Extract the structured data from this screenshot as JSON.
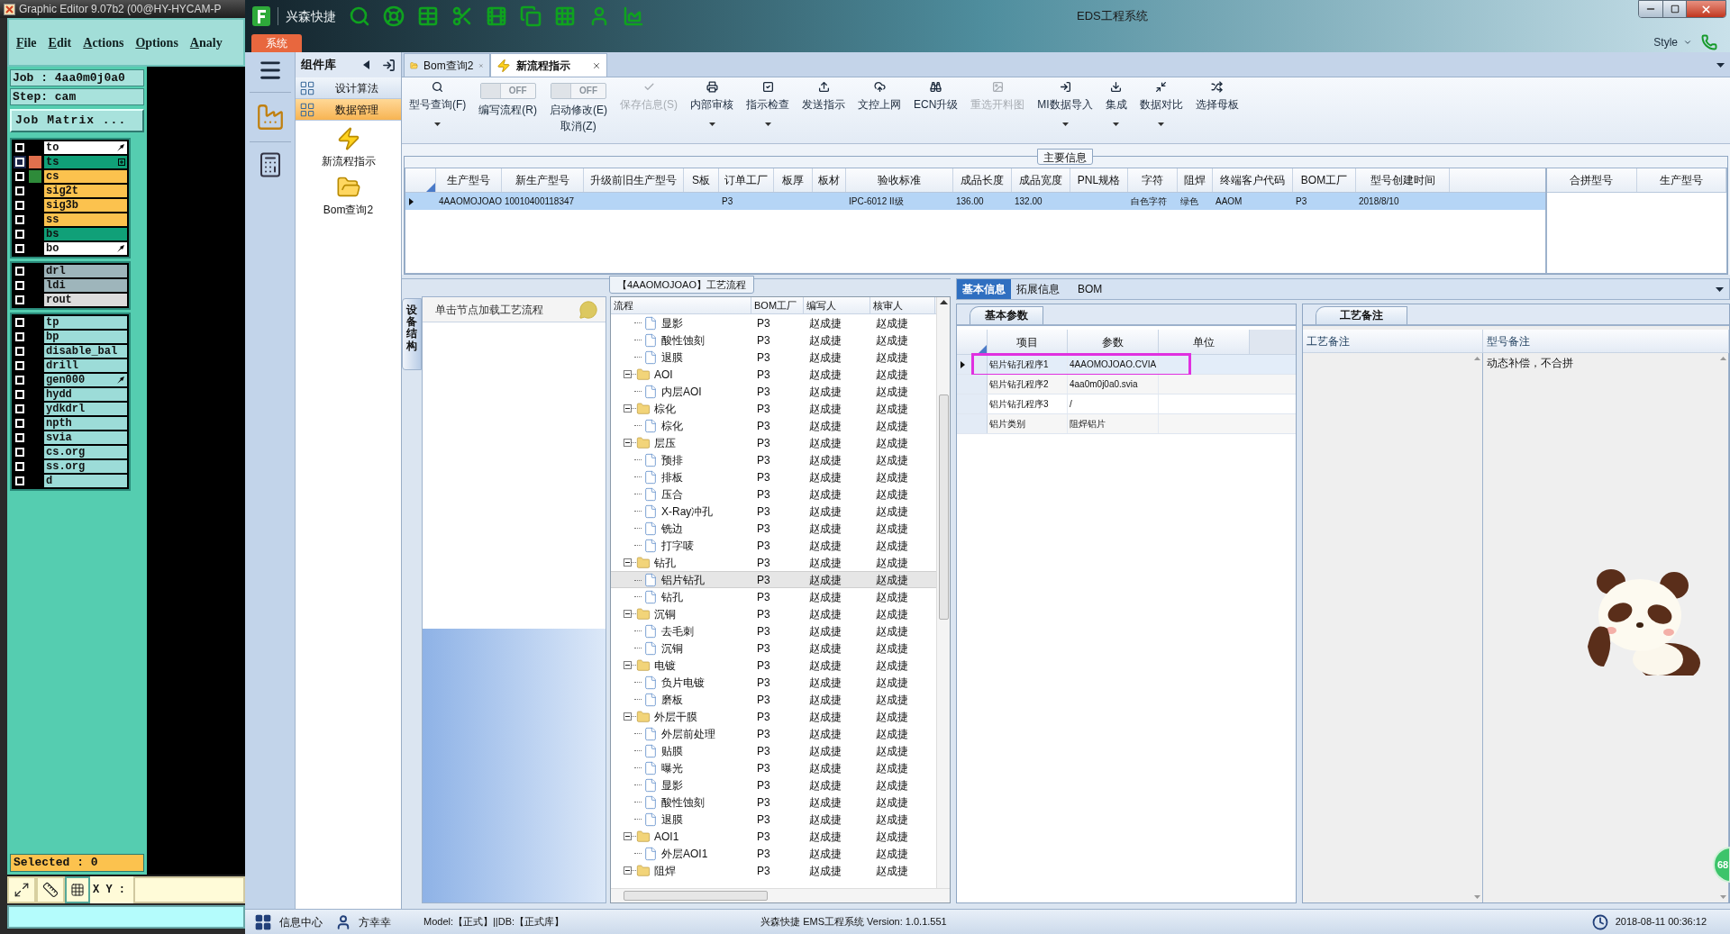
{
  "editor": {
    "title": "Graphic Editor 9.07b2 (00@HY-HYCAM-P",
    "menu": [
      "File",
      "Edit",
      "Actions",
      "Options",
      "Analy"
    ],
    "job": "Job : 4aa0m0j0a0",
    "step": "Step: cam",
    "matrix_button": "Job Matrix ...",
    "layer_groups": [
      {
        "layers": [
          {
            "name": "to",
            "color": "#ffffff",
            "selected": false,
            "marker": {
              "kind": "arrow"
            }
          },
          {
            "name": "ts",
            "color": "#10a078",
            "chip": {
              "color": "#e0704e"
            },
            "selected": true,
            "marker": {
              "kind": "plus"
            }
          },
          {
            "name": "cs",
            "color": "#fcc24e",
            "chip": {
              "color": "#2e8b3a"
            },
            "selected": false
          },
          {
            "name": "sig2t",
            "color": "#fcc24e",
            "selected": false
          },
          {
            "name": "sig3b",
            "color": "#fcc24e",
            "selected": false
          },
          {
            "name": "ss",
            "color": "#fcc24e",
            "selected": false
          },
          {
            "name": "bs",
            "color": "#10a078",
            "selected": false
          },
          {
            "name": "bo",
            "color": "#ffffff",
            "selected": false,
            "marker": {
              "kind": "arrow"
            }
          }
        ]
      },
      {
        "layers": [
          {
            "name": "drl",
            "color": "#9eb5bb",
            "selected": false
          },
          {
            "name": "ldi",
            "color": "#9eb5bb",
            "selected": false
          },
          {
            "name": "rout",
            "color": "#dcdcdc",
            "selected": false
          }
        ]
      },
      {
        "layers": [
          {
            "name": "tp",
            "color": "#9cdcd8",
            "selected": false
          },
          {
            "name": "bp",
            "color": "#9cdcd8",
            "selected": false
          },
          {
            "name": "disable_bal",
            "color": "#9cdcd8",
            "selected": false
          },
          {
            "name": "drill",
            "color": "#9cdcd8",
            "selected": false
          },
          {
            "name": "gen000",
            "color": "#9cdcd8",
            "selected": false,
            "marker": {
              "kind": "arrow"
            }
          },
          {
            "name": "hydd",
            "color": "#9cdcd8",
            "selected": false
          },
          {
            "name": "ydkdrl",
            "color": "#9cdcd8",
            "selected": false
          },
          {
            "name": "npth",
            "color": "#9cdcd8",
            "selected": false
          },
          {
            "name": "svia",
            "color": "#9cdcd8",
            "selected": false
          },
          {
            "name": "cs.org",
            "color": "#9cdcd8",
            "selected": false
          },
          {
            "name": "ss.org",
            "color": "#9cdcd8",
            "selected": false
          },
          {
            "name": "d",
            "color": "#9cdcd8",
            "selected": false
          }
        ]
      }
    ],
    "selected_count": "Selected : 0",
    "xy_label": "X Y :"
  },
  "app": {
    "quick_title": "兴森快捷",
    "title": "EDS工程系统",
    "system_tab": "系统",
    "style": "Style",
    "side": {
      "header": "组件库",
      "sections": [
        {
          "label": "设计算法",
          "selected": false
        },
        {
          "label": "数据管理",
          "selected": true
        }
      ],
      "shortcuts": [
        {
          "label": "新流程指示",
          "kind": "bolt"
        },
        {
          "label": "Bom查询2",
          "kind": "folder"
        }
      ]
    },
    "tabs": [
      {
        "label": "Bom查询2",
        "kind": "folder",
        "selected": false
      },
      {
        "label": "新流程指示",
        "kind": "bolt",
        "selected": true
      }
    ],
    "toolbar": [
      {
        "kind": "button",
        "label": "型号查询(F)",
        "disabled": false,
        "dropdown": true
      },
      {
        "kind": "toggle",
        "label": "编写流程(R)",
        "switch_text": "OFF",
        "on": false
      },
      {
        "kind": "toggle",
        "label": "启动修改(E)",
        "label2": "取消(Z)",
        "switch_text": "OFF",
        "on": false
      },
      {
        "kind": "button",
        "label": "保存信息(S)",
        "disabled": true,
        "dropdown": false
      },
      {
        "kind": "button",
        "label": "内部审核",
        "disabled": false,
        "dropdown": true
      },
      {
        "kind": "button",
        "label": "指示检查",
        "disabled": false,
        "dropdown": true
      },
      {
        "kind": "button",
        "label": "发送指示",
        "disabled": false,
        "dropdown": false
      },
      {
        "kind": "button",
        "label": "文控上网",
        "disabled": false,
        "dropdown": false
      },
      {
        "kind": "button",
        "label": "ECN升级",
        "disabled": false,
        "dropdown": false
      },
      {
        "kind": "button",
        "label": "重选开料图",
        "disabled": true,
        "dropdown": false
      },
      {
        "kind": "button",
        "label": "MI数据导入",
        "disabled": false,
        "dropdown": true
      },
      {
        "kind": "button",
        "label": "集成",
        "disabled": false,
        "dropdown": true
      },
      {
        "kind": "button",
        "label": "数据对比",
        "disabled": false,
        "dropdown": true
      },
      {
        "kind": "button",
        "label": "选择母板",
        "disabled": false,
        "dropdown": false
      }
    ],
    "main_info": {
      "title": "主要信息",
      "columns": [
        "生产型号",
        "新生产型号",
        "升级前旧生产型号",
        "S板",
        "订单工厂",
        "板厚",
        "板材",
        "验收标准",
        "成品长度",
        "成品宽度",
        "PNL规格",
        "字符",
        "阻焊",
        "终端客户代码",
        "BOM工厂",
        "型号创建时间"
      ],
      "rows": [
        {
          "selected": true,
          "cells": [
            "4AAOMOJOAO",
            "10010400118347",
            null,
            null,
            "P3",
            null,
            null,
            "IPC-6012 II级",
            "136.00",
            "132.00",
            null,
            "白色字符",
            "绿色",
            "AAOM",
            "P3",
            "2018/8/10"
          ]
        }
      ]
    },
    "merge": {
      "columns": [
        "合拼型号",
        "生产型号"
      ]
    },
    "flow": {
      "title": "【4AAOMOJOAO】工艺流程",
      "side_tab": "设备结构",
      "hint": "单击节点加载工艺流程",
      "columns": [
        "流程",
        "BOM工厂",
        "编写人",
        "核审人"
      ],
      "tree": [
        {
          "expanded": true,
          "children": [
            {
              "kind": "step",
              "name": "显影",
              "bom": "P3",
              "writer": "赵成捷",
              "reviewer": "赵成捷",
              "selected": false
            },
            {
              "kind": "step",
              "name": "酸性蚀刻",
              "bom": "P3",
              "writer": "赵成捷",
              "reviewer": "赵成捷",
              "selected": false
            },
            {
              "kind": "step",
              "name": "退膜",
              "bom": "P3",
              "writer": "赵成捷",
              "reviewer": "赵成捷",
              "selected": false
            }
          ]
        },
        {
          "kind": "folder",
          "name": "AOI",
          "bom": "P3",
          "writer": "赵成捷",
          "reviewer": "赵成捷",
          "selected": false,
          "expanded": true,
          "children": [
            {
              "kind": "step",
              "name": "内层AOI",
              "bom": "P3",
              "writer": "赵成捷",
              "reviewer": "赵成捷",
              "selected": false
            }
          ]
        },
        {
          "kind": "folder",
          "name": "棕化",
          "bom": "P3",
          "writer": "赵成捷",
          "reviewer": "赵成捷",
          "selected": false,
          "expanded": true,
          "children": [
            {
              "kind": "step",
              "name": "棕化",
              "bom": "P3",
              "writer": "赵成捷",
              "reviewer": "赵成捷",
              "selected": false
            }
          ]
        },
        {
          "kind": "folder",
          "name": "层压",
          "bom": "P3",
          "writer": "赵成捷",
          "reviewer": "赵成捷",
          "selected": false,
          "expanded": true,
          "children": [
            {
              "kind": "step",
              "name": "预排",
              "bom": "P3",
              "writer": "赵成捷",
              "reviewer": "赵成捷",
              "selected": false
            },
            {
              "kind": "step",
              "name": "排板",
              "bom": "P3",
              "writer": "赵成捷",
              "reviewer": "赵成捷",
              "selected": false
            },
            {
              "kind": "step",
              "name": "压合",
              "bom": "P3",
              "writer": "赵成捷",
              "reviewer": "赵成捷",
              "selected": false
            },
            {
              "kind": "step",
              "name": "X-Ray冲孔",
              "bom": "P3",
              "writer": "赵成捷",
              "reviewer": "赵成捷",
              "selected": false
            },
            {
              "kind": "step",
              "name": "铣边",
              "bom": "P3",
              "writer": "赵成捷",
              "reviewer": "赵成捷",
              "selected": false
            },
            {
              "kind": "step",
              "name": "打字唛",
              "bom": "P3",
              "writer": "赵成捷",
              "reviewer": "赵成捷",
              "selected": false
            }
          ]
        },
        {
          "kind": "folder",
          "name": "钻孔",
          "bom": "P3",
          "writer": "赵成捷",
          "reviewer": "赵成捷",
          "selected": false,
          "expanded": true,
          "children": [
            {
              "kind": "step",
              "name": "铝片钻孔",
              "bom": "P3",
              "writer": "赵成捷",
              "reviewer": "赵成捷",
              "selected": true
            },
            {
              "kind": "step",
              "name": "钻孔",
              "bom": "P3",
              "writer": "赵成捷",
              "reviewer": "赵成捷",
              "selected": false
            }
          ]
        },
        {
          "kind": "folder",
          "name": "沉铜",
          "bom": "P3",
          "writer": "赵成捷",
          "reviewer": "赵成捷",
          "selected": false,
          "expanded": true,
          "children": [
            {
              "kind": "step",
              "name": "去毛刺",
              "bom": "P3",
              "writer": "赵成捷",
              "reviewer": "赵成捷",
              "selected": false
            },
            {
              "kind": "step",
              "name": "沉铜",
              "bom": "P3",
              "writer": "赵成捷",
              "reviewer": "赵成捷",
              "selected": false
            }
          ]
        },
        {
          "kind": "folder",
          "name": "电镀",
          "bom": "P3",
          "writer": "赵成捷",
          "reviewer": "赵成捷",
          "selected": false,
          "expanded": true,
          "children": [
            {
              "kind": "step",
              "name": "负片电镀",
              "bom": "P3",
              "writer": "赵成捷",
              "reviewer": "赵成捷",
              "selected": false
            },
            {
              "kind": "step",
              "name": "磨板",
              "bom": "P3",
              "writer": "赵成捷",
              "reviewer": "赵成捷",
              "selected": false
            }
          ]
        },
        {
          "kind": "folder",
          "name": "外层干膜",
          "bom": "P3",
          "writer": "赵成捷",
          "reviewer": "赵成捷",
          "selected": false,
          "expanded": true,
          "children": [
            {
              "kind": "step",
              "name": "外层前处理",
              "bom": "P3",
              "writer": "赵成捷",
              "reviewer": "赵成捷",
              "selected": false
            },
            {
              "kind": "step",
              "name": "贴膜",
              "bom": "P3",
              "writer": "赵成捷",
              "reviewer": "赵成捷",
              "selected": false
            },
            {
              "kind": "step",
              "name": "曝光",
              "bom": "P3",
              "writer": "赵成捷",
              "reviewer": "赵成捷",
              "selected": false
            },
            {
              "kind": "step",
              "name": "显影",
              "bom": "P3",
              "writer": "赵成捷",
              "reviewer": "赵成捷",
              "selected": false
            },
            {
              "kind": "step",
              "name": "酸性蚀刻",
              "bom": "P3",
              "writer": "赵成捷",
              "reviewer": "赵成捷",
              "selected": false
            },
            {
              "kind": "step",
              "name": "退膜",
              "bom": "P3",
              "writer": "赵成捷",
              "reviewer": "赵成捷",
              "selected": false
            }
          ]
        },
        {
          "kind": "folder",
          "name": "AOI1",
          "bom": "P3",
          "writer": "赵成捷",
          "reviewer": "赵成捷",
          "selected": false,
          "expanded": true,
          "children": [
            {
              "kind": "step",
              "name": "外层AOI1",
              "bom": "P3",
              "writer": "赵成捷",
              "reviewer": "赵成捷",
              "selected": false
            }
          ]
        },
        {
          "kind": "folder",
          "name": "阻焊",
          "bom": "P3",
          "writer": "赵成捷",
          "reviewer": "赵成捷",
          "selected": false,
          "expanded": true
        }
      ]
    },
    "detail_tabs": [
      {
        "label": "基本信息",
        "selected": true
      },
      {
        "label": "拓展信息",
        "selected": false
      },
      {
        "label": "BOM",
        "selected": false
      }
    ],
    "params": {
      "tab": "基本参数",
      "columns": [
        "项目",
        "参数",
        "单位"
      ],
      "rows": [
        {
          "cells": [
            "铝片钻孔程序1",
            "4AAOMOJOAO.CVIA"
          ],
          "selected": true,
          "annotated": true
        },
        {
          "cells": [
            "铝片钻孔程序2",
            "4aa0m0j0a0.svia"
          ],
          "selected": false,
          "annotated": false
        },
        {
          "cells": [
            "铝片钻孔程序3",
            "/"
          ],
          "selected": false,
          "annotated": false
        },
        {
          "cells": [
            "铝片类别",
            "阻焊铝片"
          ],
          "selected": false,
          "annotated": false
        }
      ]
    },
    "notes": {
      "tab": "工艺备注",
      "columns": [
        "工艺备注",
        "型号备注"
      ],
      "model_note": "动态补偿，不合拼"
    },
    "floating_badge": "68",
    "status": {
      "info_center": "信息中心",
      "user": "方幸幸",
      "model": "Model:【正式】||DB:【正式库】",
      "version": "兴森快捷 EMS工程系统 Version: 1.0.1.551",
      "time": "2018-08-11 00:36:12"
    }
  }
}
